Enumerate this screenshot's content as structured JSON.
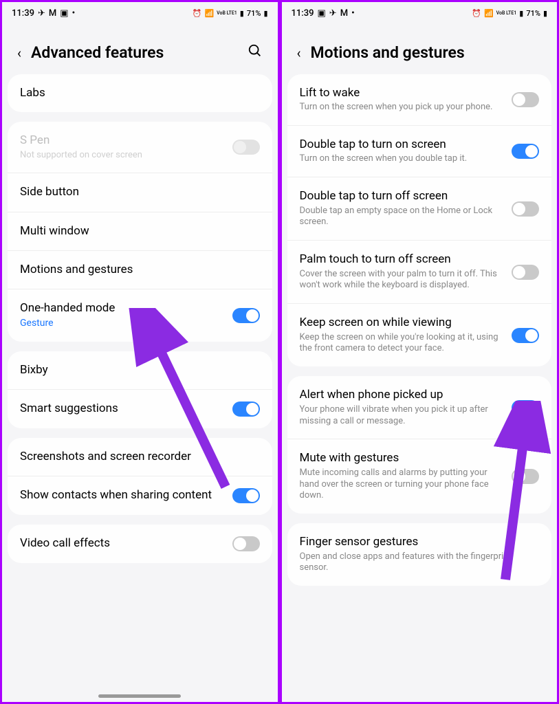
{
  "status": {
    "time": "11:39",
    "battery": "71%",
    "volte": "VoB LTE1"
  },
  "left": {
    "title": "Advanced features",
    "items": {
      "labs": "Labs",
      "spen_title": "S Pen",
      "spen_sub": "Not supported on cover screen",
      "side_button": "Side button",
      "multi_window": "Multi window",
      "motions": "Motions and gestures",
      "onehand_title": "One-handed mode",
      "onehand_sub": "Gesture",
      "bixby": "Bixby",
      "smart": "Smart suggestions",
      "screenshots": "Screenshots and screen recorder",
      "contacts": "Show contacts when sharing content",
      "video": "Video call effects"
    }
  },
  "right": {
    "title": "Motions and gestures",
    "items": {
      "lift_t": "Lift to wake",
      "lift_s": "Turn on the screen when you pick up your phone.",
      "don_t": "Double tap to turn on screen",
      "don_s": "Turn on the screen when you double tap it.",
      "doff_t": "Double tap to turn off screen",
      "doff_s": "Double tap an empty space on the Home or Lock screen.",
      "palm_t": "Palm touch to turn off screen",
      "palm_s": "Cover the screen with your palm to turn it off. This won't work while the keyboard is displayed.",
      "keep_t": "Keep screen on while viewing",
      "keep_s": "Keep the screen on while you're looking at it, using the front camera to detect your face.",
      "alert_t": "Alert when phone picked up",
      "alert_s": "Your phone will vibrate when you pick it up after missing a call or message.",
      "mute_t": "Mute with gestures",
      "mute_s": "Mute incoming calls and alarms by putting your hand over the screen or turning your phone face down.",
      "finger_t": "Finger sensor gestures",
      "finger_s": "Open and close apps and features with the fingerprint sensor."
    }
  }
}
